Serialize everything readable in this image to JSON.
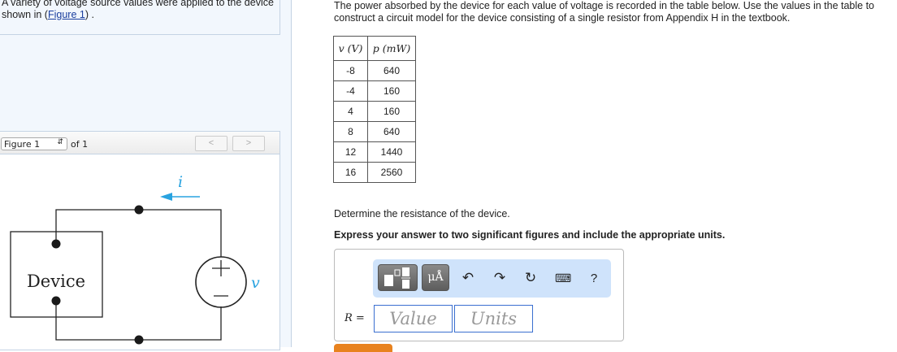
{
  "intro": {
    "text_before": "A variety of voltage source values were applied to the device shown in (",
    "link": "Figure 1",
    "text_after": ") ."
  },
  "figure": {
    "select_value": "Figure 1",
    "of_label": "of 1",
    "prev": "<",
    "next": ">",
    "device_label": "Device",
    "current_label": "i",
    "voltage_label": "v",
    "plus": "+",
    "minus": "−"
  },
  "problem": {
    "text_line1": "The power absorbed by the device for each value of voltage is recorded in the table below. Use the values in the table to",
    "text_line2": "construct a circuit model for the device consisting of a single resistor from Appendix H in the textbook."
  },
  "table": {
    "headers": [
      "v (V)",
      "p (mW)"
    ],
    "rows": [
      [
        "-8",
        "640"
      ],
      [
        "-4",
        "160"
      ],
      [
        "4",
        "160"
      ],
      [
        "8",
        "640"
      ],
      [
        "12",
        "1440"
      ],
      [
        "16",
        "2560"
      ]
    ]
  },
  "question": {
    "prompt": "Determine the resistance of the device.",
    "instruction": "Express your answer to two significant figures and include the appropriate units."
  },
  "answer": {
    "label": "R =",
    "value_placeholder": "Value",
    "units_placeholder": "Units",
    "units_button": "μÅ",
    "help": "?"
  }
}
